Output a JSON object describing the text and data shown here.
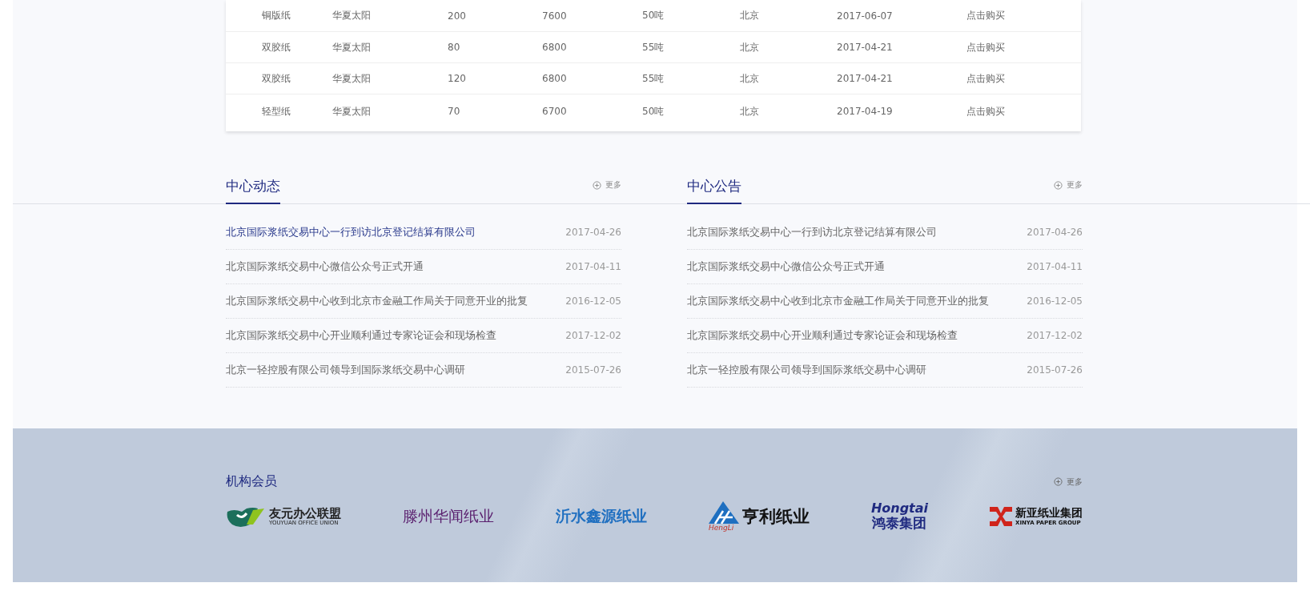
{
  "table": {
    "rows": [
      {
        "cells": [
          "铜版纸",
          "华夏太阳",
          "200",
          "7600",
          "50吨",
          "北京",
          "2017-06-07",
          "点击购买"
        ]
      },
      {
        "cells": [
          "双胶纸",
          "华夏太阳",
          "80",
          "6800",
          "55吨",
          "北京",
          "2017-04-21",
          "点击购买"
        ]
      },
      {
        "cells": [
          "双胶纸",
          "华夏太阳",
          "120",
          "6800",
          "55吨",
          "北京",
          "2017-04-21",
          "点击购买"
        ]
      },
      {
        "cells": [
          "轻型纸",
          "华夏太阳",
          "70",
          "6700",
          "50吨",
          "北京",
          "2017-04-19",
          "点击购买"
        ]
      }
    ]
  },
  "news_sections": [
    {
      "title": "中心动态",
      "more": "更多",
      "items": [
        {
          "title": "北京国际浆纸交易中心一行到访北京登记结算有限公司",
          "date": "2017-04-26",
          "highlighted": true
        },
        {
          "title": "北京国际浆纸交易中心微信公众号正式开通",
          "date": "2017-04-11",
          "highlighted": false
        },
        {
          "title": "北京国际浆纸交易中心收到北京市金融工作局关于同意开业的批复",
          "date": "2016-12-05",
          "highlighted": false
        },
        {
          "title": "北京国际浆纸交易中心开业顺利通过专家论证会和现场检查",
          "date": "2017-12-02",
          "highlighted": false
        },
        {
          "title": "北京一轻控股有限公司领导到国际浆纸交易中心调研",
          "date": "2015-07-26",
          "highlighted": false
        }
      ]
    },
    {
      "title": "中心公告",
      "more": "更多",
      "items": [
        {
          "title": "北京国际浆纸交易中心一行到访北京登记结算有限公司",
          "date": "2017-04-26",
          "highlighted": false
        },
        {
          "title": "北京国际浆纸交易中心微信公众号正式开通",
          "date": "2017-04-11",
          "highlighted": false
        },
        {
          "title": "北京国际浆纸交易中心收到北京市金融工作局关于同意开业的批复",
          "date": "2016-12-05",
          "highlighted": false
        },
        {
          "title": "北京国际浆纸交易中心开业顺利通过专家论证会和现场检查",
          "date": "2017-12-02",
          "highlighted": false
        },
        {
          "title": "北京一轻控股有限公司领导到国际浆纸交易中心调研",
          "date": "2015-07-26",
          "highlighted": false
        }
      ]
    }
  ],
  "members": {
    "title": "机构会员",
    "more": "更多",
    "logos": [
      {
        "kind": "leaf",
        "name": "友元办公联盟",
        "sub": "YOUYUAN OFFICE UNION"
      },
      {
        "kind": "serif",
        "name": "滕州华闻纸业"
      },
      {
        "kind": "bold",
        "name": "沂水鑫源纸业"
      },
      {
        "kind": "triangle",
        "name": "亨利纸业",
        "sub": "HengLi"
      },
      {
        "kind": "wordmark",
        "name": "鸿泰集团",
        "sub": "Hongtai"
      },
      {
        "kind": "cross",
        "name": "新亚纸业集团",
        "sub": "XINYA PAPER GROUP"
      }
    ]
  }
}
